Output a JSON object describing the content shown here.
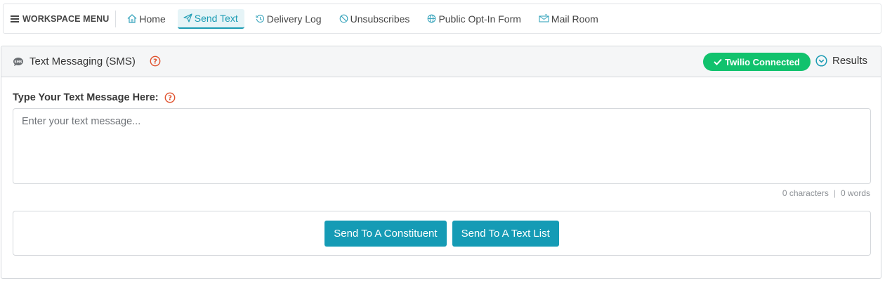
{
  "nav": {
    "workspace_menu": "WORKSPACE MENU",
    "items": [
      {
        "label": "Home",
        "icon": "home-icon",
        "active": false
      },
      {
        "label": "Send Text",
        "icon": "paper-plane-icon",
        "active": true
      },
      {
        "label": "Delivery Log",
        "icon": "history-icon",
        "active": false
      },
      {
        "label": "Unsubscribes",
        "icon": "ban-icon",
        "active": false
      },
      {
        "label": "Public Opt-In Form",
        "icon": "globe-icon",
        "active": false
      },
      {
        "label": "Mail Room",
        "icon": "mailbox-icon",
        "active": false
      }
    ]
  },
  "panel": {
    "title": "Text Messaging (SMS)",
    "status_badge": "Twilio Connected",
    "results_label": "Results"
  },
  "message": {
    "label": "Type Your Text Message Here:",
    "placeholder": "Enter your text message...",
    "value": "",
    "characters": "0 characters",
    "separator": "|",
    "words": "0 words"
  },
  "actions": {
    "send_constituent": "Send To A Constituent",
    "send_list": "Send To A Text List"
  },
  "colors": {
    "accent": "#159bb5",
    "success": "#11c26d",
    "help": "#e0522e"
  }
}
